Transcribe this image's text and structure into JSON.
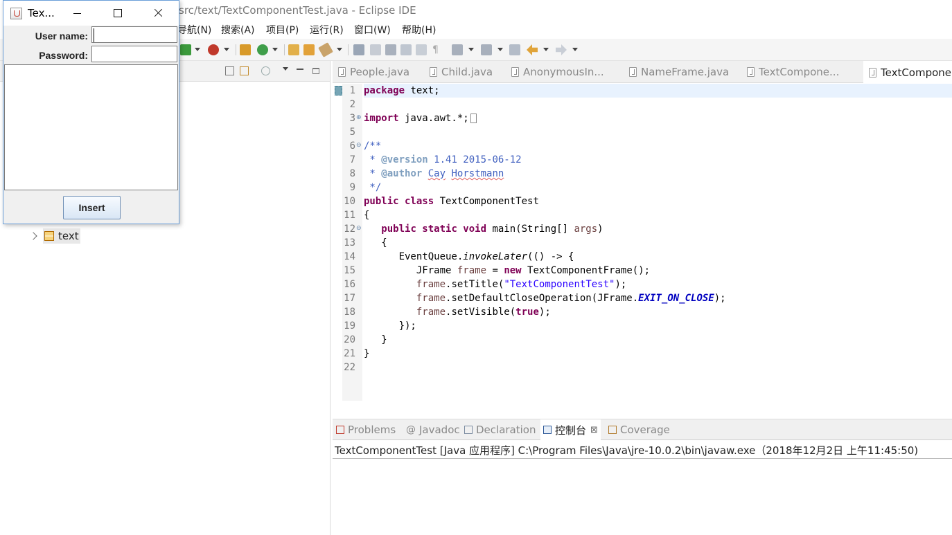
{
  "eclipse": {
    "title": "src/text/TextComponentTest.java - Eclipse IDE",
    "menus": [
      "导航(N)",
      "搜索(A)",
      "项目(P)",
      "运行(R)",
      "窗口(W)",
      "帮助(H)"
    ]
  },
  "explorer": {
    "tree": [
      {
        "label": "text",
        "icon": "package-icon",
        "expanded": false
      }
    ]
  },
  "editor": {
    "tabs": [
      {
        "label": "People.java",
        "active": false
      },
      {
        "label": "Child.java",
        "active": false
      },
      {
        "label": "AnonymousIn...",
        "active": false
      },
      {
        "label": "NameFrame.java",
        "active": false
      },
      {
        "label": "TextCompone...",
        "active": false
      },
      {
        "label": "TextCompone",
        "active": true
      }
    ],
    "line_numbers": [
      "1",
      "2",
      "3",
      "5",
      "6",
      "7",
      "8",
      "9",
      "10",
      "11",
      "12",
      "13",
      "14",
      "15",
      "16",
      "17",
      "18",
      "19",
      "20",
      "21",
      "22"
    ],
    "code": {
      "l1_kw": "package",
      "l1_rest": " text;",
      "l3_kw": "import",
      "l3_rest": " java.awt.*;",
      "l6": "/**",
      "l7_pre": " * ",
      "l7_tag": "@version",
      "l7_rest": " 1.41 2015-06-12",
      "l8_pre": " * ",
      "l8_tag": "@author",
      "l8_a": "Cay",
      "l8_b": "Horstmann",
      "l9": " */",
      "l10_kw": "public class",
      "l10_rest": " TextComponentTest",
      "l11": "{",
      "l12_kw": "public static void",
      "l12_a": " main(String[] ",
      "l12_var": "args",
      "l12_b": ")",
      "l13": "{",
      "l14_a": "EventQueue.",
      "l14_m": "invokeLater",
      "l14_b": "(() -> {",
      "l15_a": "JFrame ",
      "l15_var": "frame",
      "l15_b": " = ",
      "l15_kw": "new",
      "l15_c": " TextComponentFrame();",
      "l16_f": "frame",
      "l16_a": ".setTitle(",
      "l16_s": "\"TextComponentTest\"",
      "l16_b": ");",
      "l17_f": "frame",
      "l17_a": ".setDefaultCloseOperation(JFrame.",
      "l17_c": "EXIT_ON_CLOSE",
      "l17_b": ");",
      "l18_f": "frame",
      "l18_a": ".setVisible(",
      "l18_kw": "true",
      "l18_b": ");",
      "l19": "});",
      "l20": "}",
      "l21": "}"
    }
  },
  "console": {
    "tabs": [
      {
        "label": "Problems",
        "active": false
      },
      {
        "label": "Javadoc",
        "active": false
      },
      {
        "label": "Declaration",
        "active": false
      },
      {
        "label": "控制台",
        "active": true
      },
      {
        "label": "Coverage",
        "active": false
      }
    ],
    "close_glyph": "⊠",
    "status_line": "TextComponentTest [Java 应用程序] C:\\Program Files\\Java\\jre-10.0.2\\bin\\javaw.exe（2018年12月2日 上午11:45:50)"
  },
  "swing_window": {
    "title": "Tex...",
    "username_label": "User name:",
    "password_label": "Password:",
    "username_value": "",
    "password_value": "",
    "insert_label": "Insert"
  },
  "colors": {
    "keyword": "#7f0055",
    "comment": "#3f5fbf",
    "string": "#2a00ff",
    "field": "#0000c0",
    "window_border": "#6a9ed8"
  }
}
